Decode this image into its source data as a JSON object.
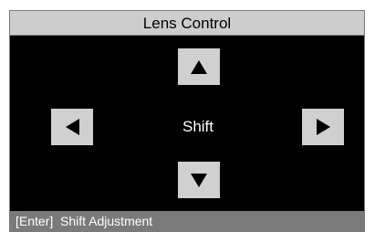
{
  "window": {
    "title": "Lens Control"
  },
  "controls": {
    "center_label": "Shift",
    "up_icon": "triangle-up-icon",
    "down_icon": "triangle-down-icon",
    "left_icon": "triangle-left-icon",
    "right_icon": "triangle-right-icon"
  },
  "status_bar": {
    "key": "[Enter]",
    "text": "Shift Adjustment"
  },
  "colors": {
    "background": "#000000",
    "title_bar": "#cdcdcd",
    "button": "#d0d0d0",
    "icon": "#000000",
    "status_bar": "#7a7a7a",
    "label_text": "#ffffff"
  }
}
